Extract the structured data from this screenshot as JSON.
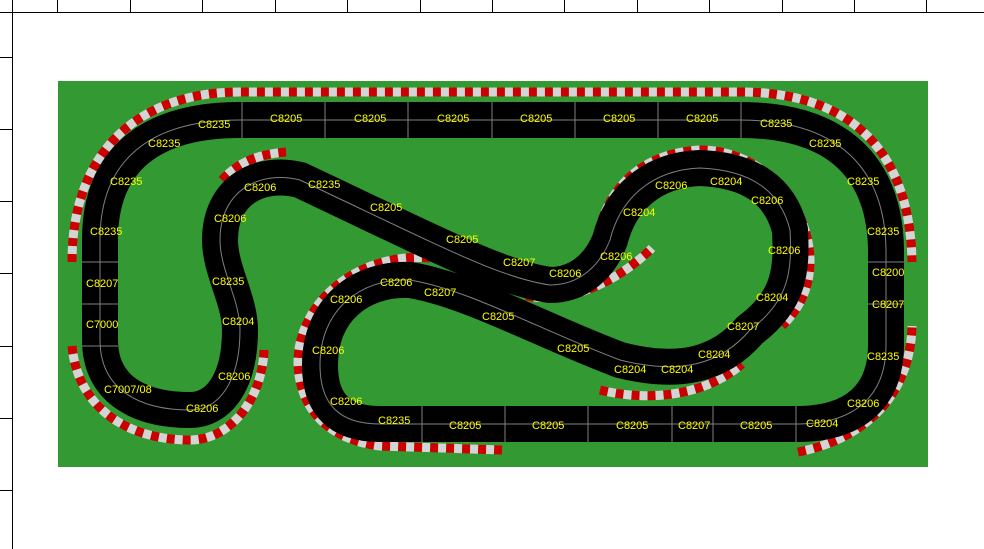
{
  "colors": {
    "table": "#339933",
    "track": "#000000",
    "lane_line": "#808080",
    "curb_red": "#cc0000",
    "curb_white": "#d4d4d4",
    "label": "#ffff00"
  },
  "piece_labels": {
    "top_1": "C8235",
    "top_2": "C8205",
    "top_3": "C8205",
    "top_4": "C8205",
    "top_5": "C8205",
    "top_6": "C8205",
    "top_7": "C8205",
    "top_8": "C8235",
    "tl_1": "C8235",
    "tl_2": "C8235",
    "tl_3": "C8235",
    "left_1": "C8207",
    "left_2": "C7000",
    "left_3": "C7007/08",
    "bl_1": "C8206",
    "bl_2": "C8206",
    "bl_3": "C8204",
    "s_1": "C8235",
    "s_2": "C8206",
    "s_3": "C8206",
    "diag_1": "C8235",
    "diag_2": "C8205",
    "diag_3": "C8205",
    "diag_4": "C8207",
    "diag_5": "C8206",
    "loop_1": "C8206",
    "loop_2": "C8204",
    "loop_3": "C8204",
    "loop_4": "C8206",
    "loop_5": "C8206",
    "loop_6": "C8206",
    "loop_7": "C8204",
    "loop_8": "C8207",
    "loop_9": "C8204",
    "lower_1": "C8204",
    "lower_2": "C8204",
    "mid_1": "C8206",
    "mid_2": "C8206",
    "mid_3": "C8207",
    "mid_4": "C8205",
    "mid_5": "C8205",
    "mid_6": "C8206",
    "mid_7": "C8206",
    "bottom_1": "C8235",
    "bottom_2": "C8205",
    "bottom_3": "C8205",
    "bottom_4": "C8205",
    "bottom_5": "C8207",
    "bottom_6": "C8205",
    "bottom_7": "C8204",
    "right_1": "C8235",
    "right_2": "C8235",
    "right_3": "C8235",
    "right_4": "C8235",
    "right_5": "C8200",
    "right_6": "C8207",
    "right_7": "C8235",
    "right_8": "C8206"
  }
}
